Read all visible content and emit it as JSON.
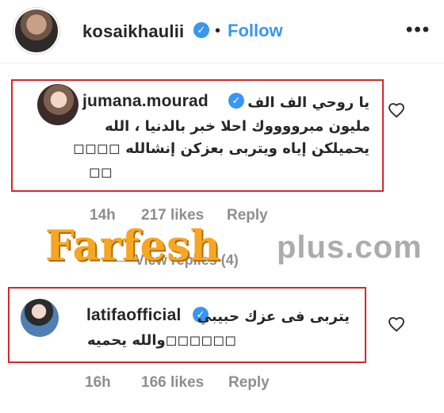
{
  "header": {
    "username": "kosaikhaulii",
    "verified_mark": "✓",
    "separator": "•",
    "follow_label": "Follow",
    "more_label": "•••",
    "accent_color": "#3897f0"
  },
  "comments": [
    {
      "username": "jumana.mourad",
      "verified_mark": "✓",
      "text_lines": [
        "يا روحي الف الف",
        "مليون مبرووووك احلا خبر بالدنيا ، الله",
        "يحميلكن إياه ويتربى بعزكن إنشالله ◻◻◻◻",
        "◻◻"
      ],
      "time": "14h",
      "likes": "217 likes",
      "reply_label": "Reply"
    },
    {
      "username": "latifaofficial",
      "verified_mark": "✓",
      "text_lines": [
        "يتربى فى عزك حبيبي",
        "والله يحميه◻◻◻◻◻◻"
      ],
      "time": "16h",
      "likes": "166 likes",
      "reply_label": "Reply"
    }
  ],
  "view_replies_label": "View replies (4)",
  "watermark": {
    "main_text": "Farfesh",
    "plus_text": "plus.com",
    "main_color": "#f5a623",
    "plus_color": "#9e9e9e"
  },
  "highlight_color": "#d62828",
  "icons": {
    "heart": "heart-outline-icon",
    "verified": "verified-badge-icon",
    "more": "more-options-icon"
  }
}
